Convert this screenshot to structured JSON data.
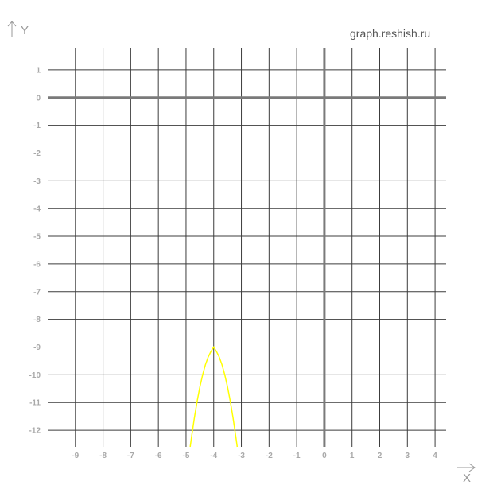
{
  "watermark": "graph.reshish.ru",
  "chart_data": {
    "type": "line",
    "title": "",
    "xlabel": "X",
    "ylabel": "Y",
    "xlim": [
      -10,
      4.4
    ],
    "ylim": [
      -12.6,
      1.8
    ],
    "xticks": [
      -9,
      -8,
      -7,
      -6,
      -5,
      -4,
      -3,
      -2,
      -1,
      0,
      1,
      2,
      3,
      4
    ],
    "yticks": [
      1,
      0,
      -1,
      -2,
      -3,
      -4,
      -5,
      -6,
      -7,
      -8,
      -9,
      -10,
      -11,
      -12
    ],
    "grid": true,
    "series": [
      {
        "color": "#ffff00",
        "x": [
          -4.85,
          -4.8,
          -4.7,
          -4.6,
          -4.5,
          -4.4,
          -4.3,
          -4.2,
          -4.1,
          -4.0,
          -3.9,
          -3.8,
          -3.7,
          -3.6,
          -3.5,
          -3.4,
          -3.3,
          -3.2,
          -3.15
        ],
        "y": [
          -12.61,
          -12.24,
          -11.56,
          -10.96,
          -10.44,
          -10.0,
          -9.64,
          -9.36,
          -9.16,
          -9.0,
          -9.16,
          -9.36,
          -9.64,
          -10.0,
          -10.44,
          -10.96,
          -11.56,
          -12.24,
          -12.61
        ]
      }
    ]
  },
  "colors": {
    "grid": "#3c3c3c",
    "axis": "#7a7a7a",
    "tick": "#a9a9a9",
    "curve": "#ffff00"
  }
}
